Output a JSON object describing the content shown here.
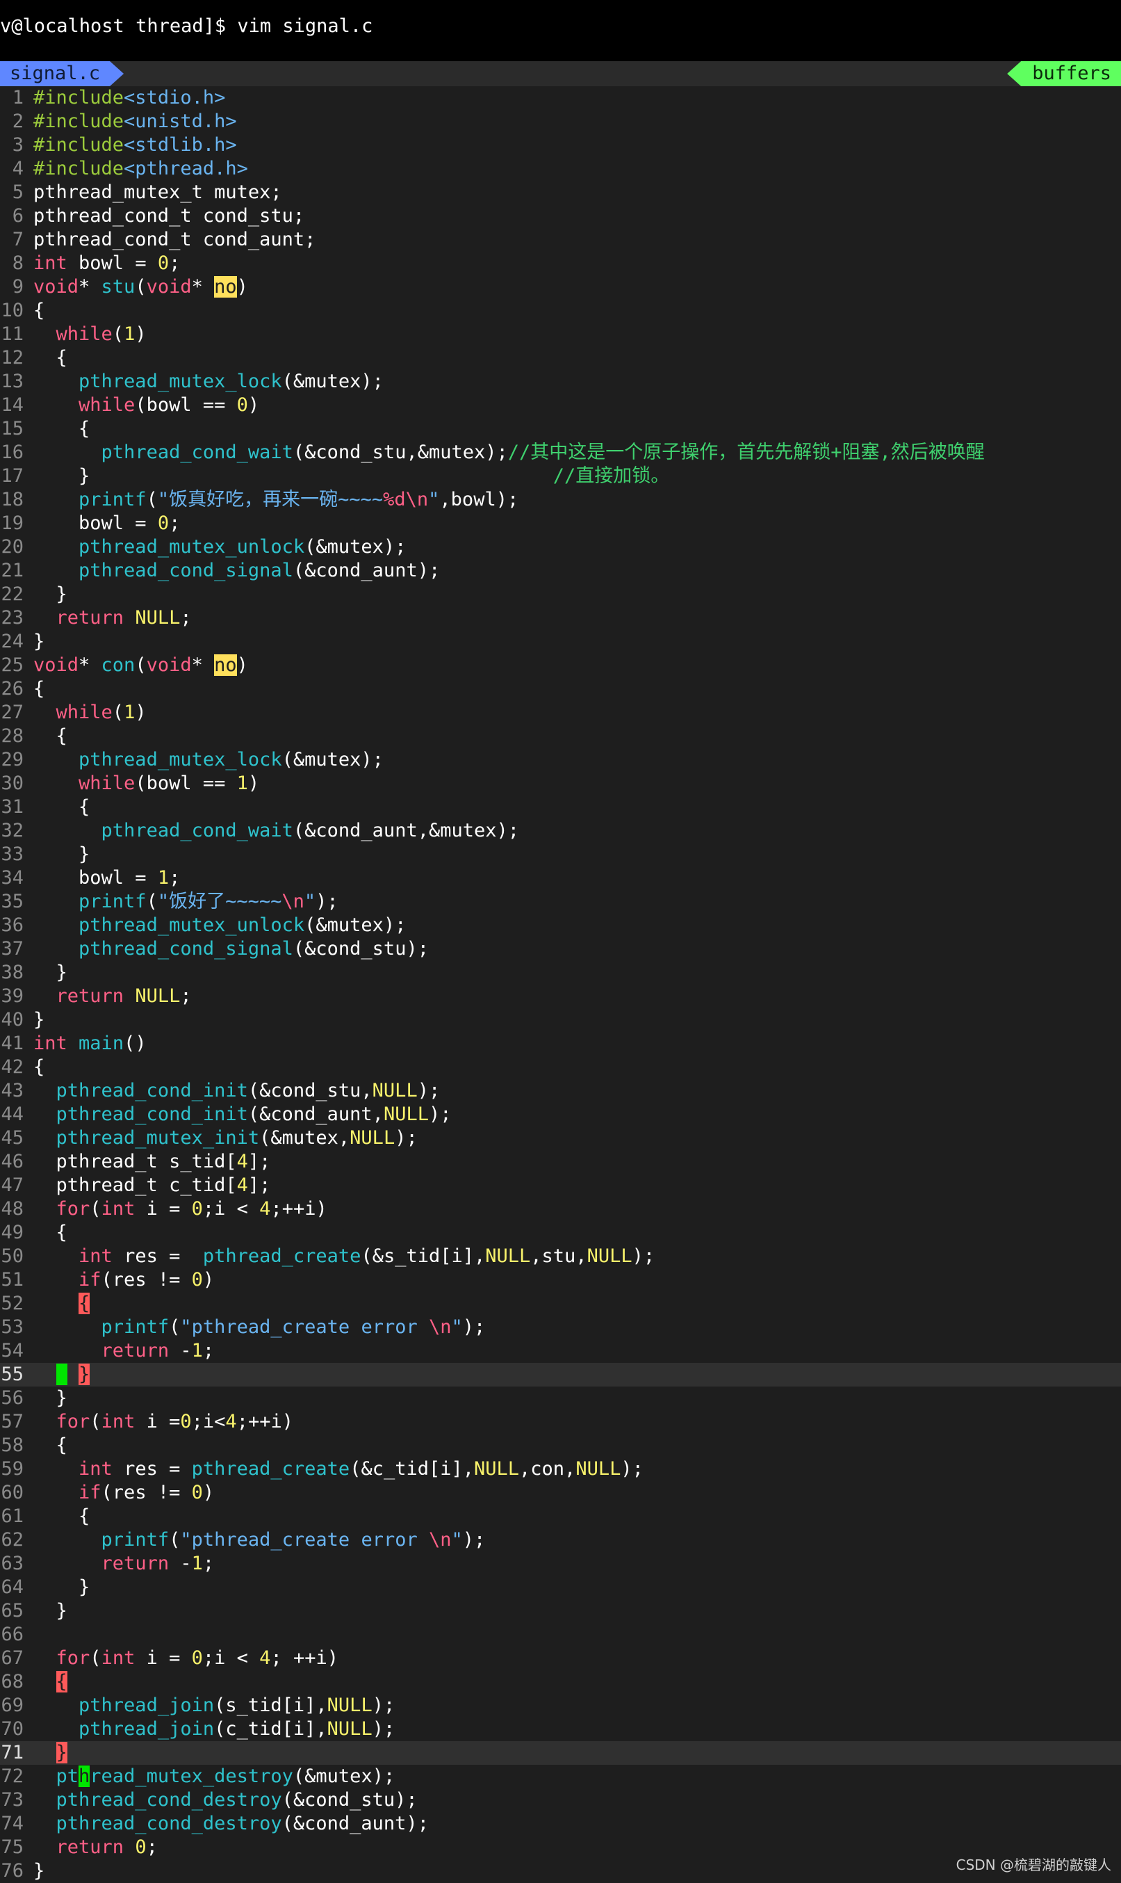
{
  "terminal": {
    "prompt_line": "v@localhost thread]$ vim signal.c"
  },
  "tabline": {
    "file_tab": "signal.c",
    "buffers_label": "buffers"
  },
  "editor": {
    "cursor_lines": [
      55,
      71
    ],
    "lines": [
      [
        [
          "pp",
          "#include"
        ],
        [
          "str",
          "<stdio.h>"
        ]
      ],
      [
        [
          "pp",
          "#include"
        ],
        [
          "str",
          "<unistd.h>"
        ]
      ],
      [
        [
          "pp",
          "#include"
        ],
        [
          "str",
          "<stdlib.h>"
        ]
      ],
      [
        [
          "pp",
          "#include"
        ],
        [
          "str",
          "<pthread.h>"
        ]
      ],
      [
        [
          "",
          "pthread_mutex_t mutex;"
        ]
      ],
      [
        [
          "",
          "pthread_cond_t cond_stu;"
        ]
      ],
      [
        [
          "",
          "pthread_cond_t cond_aunt;"
        ]
      ],
      [
        [
          "kw",
          "int"
        ],
        [
          "",
          " bowl = "
        ],
        [
          "num",
          "0"
        ],
        [
          "",
          ";"
        ]
      ],
      [
        [
          "kw",
          "void"
        ],
        [
          "",
          "* "
        ],
        [
          "fn",
          "stu"
        ],
        [
          "",
          "("
        ],
        [
          "kw",
          "void"
        ],
        [
          "",
          "* "
        ],
        [
          "hl",
          "no"
        ],
        [
          "",
          ")"
        ]
      ],
      [
        [
          "",
          "{"
        ]
      ],
      [
        [
          "",
          "  "
        ],
        [
          "kw",
          "while"
        ],
        [
          "",
          "("
        ],
        [
          "num",
          "1"
        ],
        [
          "",
          ")"
        ]
      ],
      [
        [
          "",
          "  {"
        ]
      ],
      [
        [
          "",
          "    "
        ],
        [
          "fn",
          "pthread_mutex_lock"
        ],
        [
          "",
          "(&mutex);"
        ]
      ],
      [
        [
          "",
          "    "
        ],
        [
          "kw",
          "while"
        ],
        [
          "",
          "(bowl == "
        ],
        [
          "num",
          "0"
        ],
        [
          "",
          ")"
        ]
      ],
      [
        [
          "",
          "    {"
        ]
      ],
      [
        [
          "",
          "      "
        ],
        [
          "fn",
          "pthread_cond_wait"
        ],
        [
          "",
          "(&cond_stu,&mutex);"
        ],
        [
          "cmt",
          "//其中这是一个原子操作，首先先解锁+阻塞,然后被唤醒"
        ]
      ],
      [
        [
          "",
          "    }                                         "
        ],
        [
          "cmt",
          "//直接加锁。"
        ]
      ],
      [
        [
          "",
          "    "
        ],
        [
          "fn",
          "printf"
        ],
        [
          "",
          "("
        ],
        [
          "str",
          "\"饭真好吃，再来一碗~~~~"
        ],
        [
          "esc",
          "%d\\n"
        ],
        [
          "str",
          "\""
        ],
        [
          "",
          ",bowl);"
        ]
      ],
      [
        [
          "",
          "    bowl = "
        ],
        [
          "num",
          "0"
        ],
        [
          "",
          ";"
        ]
      ],
      [
        [
          "",
          "    "
        ],
        [
          "fn",
          "pthread_mutex_unlock"
        ],
        [
          "",
          "(&mutex);"
        ]
      ],
      [
        [
          "",
          "    "
        ],
        [
          "fn",
          "pthread_cond_signal"
        ],
        [
          "",
          "(&cond_aunt);"
        ]
      ],
      [
        [
          "",
          "  }"
        ]
      ],
      [
        [
          "",
          "  "
        ],
        [
          "kw",
          "return"
        ],
        [
          "",
          "",
          " "
        ],
        [
          "num",
          "NULL"
        ],
        [
          "",
          ";"
        ]
      ],
      [
        [
          "",
          "}"
        ]
      ],
      [
        [
          "kw",
          "void"
        ],
        [
          "",
          "* "
        ],
        [
          "fn",
          "con"
        ],
        [
          "",
          "("
        ],
        [
          "kw",
          "void"
        ],
        [
          "",
          "* "
        ],
        [
          "hl",
          "no"
        ],
        [
          "",
          ")"
        ]
      ],
      [
        [
          "",
          "{"
        ]
      ],
      [
        [
          "",
          "  "
        ],
        [
          "kw",
          "while"
        ],
        [
          "",
          "("
        ],
        [
          "num",
          "1"
        ],
        [
          "",
          ")"
        ]
      ],
      [
        [
          "",
          "  {"
        ]
      ],
      [
        [
          "",
          "    "
        ],
        [
          "fn",
          "pthread_mutex_lock"
        ],
        [
          "",
          "(&mutex);"
        ]
      ],
      [
        [
          "",
          "    "
        ],
        [
          "kw",
          "while"
        ],
        [
          "",
          "(bowl == "
        ],
        [
          "num",
          "1"
        ],
        [
          "",
          ")"
        ]
      ],
      [
        [
          "",
          "    {"
        ]
      ],
      [
        [
          "",
          "      "
        ],
        [
          "fn",
          "pthread_cond_wait"
        ],
        [
          "",
          "(&cond_aunt,&mutex);"
        ]
      ],
      [
        [
          "",
          "    }"
        ]
      ],
      [
        [
          "",
          "    bowl = "
        ],
        [
          "num",
          "1"
        ],
        [
          "",
          ";"
        ]
      ],
      [
        [
          "",
          "    "
        ],
        [
          "fn",
          "printf"
        ],
        [
          "",
          "("
        ],
        [
          "str",
          "\"饭好了~~~~~"
        ],
        [
          "esc",
          "\\n"
        ],
        [
          "str",
          "\""
        ],
        [
          "",
          ");"
        ]
      ],
      [
        [
          "",
          "    "
        ],
        [
          "fn",
          "pthread_mutex_unlock"
        ],
        [
          "",
          "(&mutex);"
        ]
      ],
      [
        [
          "",
          "    "
        ],
        [
          "fn",
          "pthread_cond_signal"
        ],
        [
          "",
          "(&cond_stu);"
        ]
      ],
      [
        [
          "",
          "  }"
        ]
      ],
      [
        [
          "",
          "  "
        ],
        [
          "kw",
          "return"
        ],
        [
          "",
          " "
        ],
        [
          "num",
          "NULL"
        ],
        [
          "",
          ";"
        ]
      ],
      [
        [
          "",
          "}"
        ]
      ],
      [
        [
          "kw",
          "int"
        ],
        [
          "",
          " "
        ],
        [
          "fn",
          "main"
        ],
        [
          "",
          "()"
        ]
      ],
      [
        [
          "",
          "{"
        ]
      ],
      [
        [
          "",
          "  "
        ],
        [
          "fn",
          "pthread_cond_init"
        ],
        [
          "",
          "(&cond_stu,"
        ],
        [
          "num",
          "NULL"
        ],
        [
          "",
          ");"
        ]
      ],
      [
        [
          "",
          "  "
        ],
        [
          "fn",
          "pthread_cond_init"
        ],
        [
          "",
          "(&cond_aunt,"
        ],
        [
          "num",
          "NULL"
        ],
        [
          "",
          ");"
        ]
      ],
      [
        [
          "",
          "  "
        ],
        [
          "fn",
          "pthread_mutex_init"
        ],
        [
          "",
          "(&mutex,"
        ],
        [
          "num",
          "NULL"
        ],
        [
          "",
          ");"
        ]
      ],
      [
        [
          "",
          "  pthread_t s_tid["
        ],
        [
          "num",
          "4"
        ],
        [
          "",
          "];"
        ]
      ],
      [
        [
          "",
          "  pthread_t c_tid["
        ],
        [
          "num",
          "4"
        ],
        [
          "",
          "];"
        ]
      ],
      [
        [
          "",
          "  "
        ],
        [
          "kw",
          "for"
        ],
        [
          "",
          "("
        ],
        [
          "kw",
          "int"
        ],
        [
          "",
          " i = "
        ],
        [
          "num",
          "0"
        ],
        [
          "",
          ";i < "
        ],
        [
          "num",
          "4"
        ],
        [
          "",
          ";++i)"
        ]
      ],
      [
        [
          "",
          "  {"
        ]
      ],
      [
        [
          "",
          "    "
        ],
        [
          "kw",
          "int"
        ],
        [
          "",
          " res =  "
        ],
        [
          "fn",
          "pthread_create"
        ],
        [
          "",
          "(&s_tid[i],"
        ],
        [
          "num",
          "NULL"
        ],
        [
          "",
          ",stu,"
        ],
        [
          "num",
          "NULL"
        ],
        [
          "",
          ");"
        ]
      ],
      [
        [
          "",
          "    "
        ],
        [
          "kw",
          "if"
        ],
        [
          "",
          "(res != "
        ],
        [
          "num",
          "0"
        ],
        [
          "",
          ")"
        ]
      ],
      [
        [
          "",
          "    "
        ],
        [
          "mb",
          "{"
        ]
      ],
      [
        [
          "",
          "      "
        ],
        [
          "fn",
          "printf"
        ],
        [
          "",
          "("
        ],
        [
          "str",
          "\"pthread_create error "
        ],
        [
          "esc",
          "\\n"
        ],
        [
          "str",
          "\""
        ],
        [
          "",
          ");"
        ]
      ],
      [
        [
          "",
          "      "
        ],
        [
          "kw",
          "return"
        ],
        [
          "",
          " -"
        ],
        [
          "num",
          "1"
        ],
        [
          "",
          ";"
        ]
      ],
      [
        [
          "",
          "  "
        ],
        [
          "cursor-blk",
          " "
        ],
        [
          "",
          " "
        ],
        [
          "mb",
          "}"
        ]
      ],
      [
        [
          "",
          "  }"
        ]
      ],
      [
        [
          "",
          "  "
        ],
        [
          "kw",
          "for"
        ],
        [
          "",
          "("
        ],
        [
          "kw",
          "int"
        ],
        [
          "",
          " i ="
        ],
        [
          "num",
          "0"
        ],
        [
          "",
          ";i<"
        ],
        [
          "num",
          "4"
        ],
        [
          "",
          ";++i)"
        ]
      ],
      [
        [
          "",
          "  {"
        ]
      ],
      [
        [
          "",
          "    "
        ],
        [
          "kw",
          "int"
        ],
        [
          "",
          " res = "
        ],
        [
          "fn",
          "pthread_create"
        ],
        [
          "",
          "(&c_tid[i],"
        ],
        [
          "num",
          "NULL"
        ],
        [
          "",
          ",con,"
        ],
        [
          "num",
          "NULL"
        ],
        [
          "",
          ");"
        ]
      ],
      [
        [
          "",
          "    "
        ],
        [
          "kw",
          "if"
        ],
        [
          "",
          "(res != "
        ],
        [
          "num",
          "0"
        ],
        [
          "",
          ")"
        ]
      ],
      [
        [
          "",
          "    {"
        ]
      ],
      [
        [
          "",
          "      "
        ],
        [
          "fn",
          "printf"
        ],
        [
          "",
          "("
        ],
        [
          "str",
          "\"pthread_create error "
        ],
        [
          "esc",
          "\\n"
        ],
        [
          "str",
          "\""
        ],
        [
          "",
          ");"
        ]
      ],
      [
        [
          "",
          "      "
        ],
        [
          "kw",
          "return"
        ],
        [
          "",
          " -"
        ],
        [
          "num",
          "1"
        ],
        [
          "",
          ";"
        ]
      ],
      [
        [
          "",
          "    }"
        ]
      ],
      [
        [
          "",
          "  }"
        ]
      ],
      [
        [
          "",
          ""
        ]
      ],
      [
        [
          "",
          "  "
        ],
        [
          "kw",
          "for"
        ],
        [
          "",
          "("
        ],
        [
          "kw",
          "int"
        ],
        [
          "",
          " i = "
        ],
        [
          "num",
          "0"
        ],
        [
          "",
          ";i < "
        ],
        [
          "num",
          "4"
        ],
        [
          "",
          "; ++i)"
        ]
      ],
      [
        [
          "",
          "  "
        ],
        [
          "mb",
          "{"
        ]
      ],
      [
        [
          "",
          "    "
        ],
        [
          "fn",
          "pthread_join"
        ],
        [
          "",
          "(s_tid[i],"
        ],
        [
          "num",
          "NULL"
        ],
        [
          "",
          ");"
        ]
      ],
      [
        [
          "",
          "    "
        ],
        [
          "fn",
          "pthread_join"
        ],
        [
          "",
          "(c_tid[i],"
        ],
        [
          "num",
          "NULL"
        ],
        [
          "",
          ");"
        ]
      ],
      [
        [
          "",
          "  "
        ],
        [
          "mb",
          "}"
        ]
      ],
      [
        [
          "",
          "  "
        ],
        [
          "fn",
          "pt"
        ],
        [
          "cursor-blk",
          "h"
        ],
        [
          "fn",
          "read_mutex_destroy"
        ],
        [
          "",
          "(&mutex);"
        ]
      ],
      [
        [
          "",
          "  "
        ],
        [
          "fn",
          "pthread_cond_destroy"
        ],
        [
          "",
          "(&cond_stu);"
        ]
      ],
      [
        [
          "",
          "  "
        ],
        [
          "fn",
          "pthread_cond_destroy"
        ],
        [
          "",
          "(&cond_aunt);"
        ]
      ],
      [
        [
          "",
          "  "
        ],
        [
          "kw",
          "return"
        ],
        [
          "",
          " "
        ],
        [
          "num",
          "0"
        ],
        [
          "",
          ";"
        ]
      ],
      [
        [
          "",
          "}"
        ]
      ]
    ]
  },
  "watermark": "CSDN @梳碧湖的敲键人"
}
